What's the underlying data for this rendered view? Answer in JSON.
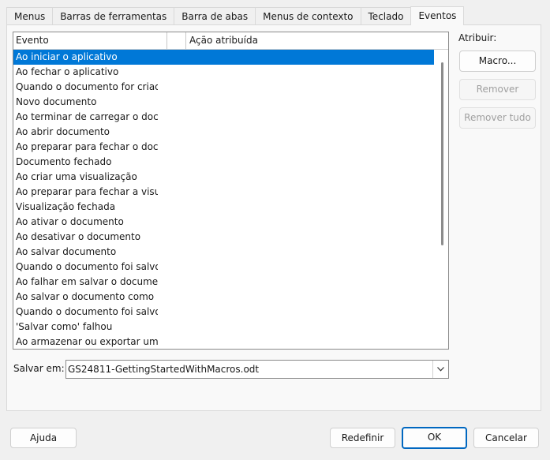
{
  "tabs": [
    "Menus",
    "Barras de ferramentas",
    "Barra de abas",
    "Menus de contexto",
    "Teclado",
    "Eventos"
  ],
  "active_tab": "Eventos",
  "events_table": {
    "header_event": "Evento",
    "header_action": "Ação atribuída",
    "rows": [
      "Ao iniciar o aplicativo",
      "Ao fechar o aplicativo",
      "Quando o documento for criado",
      "Novo documento",
      "Ao terminar de carregar o docume",
      "Ao abrir documento",
      "Ao preparar para fechar o docume",
      "Documento fechado",
      "Ao criar uma visualização",
      "Ao preparar para fechar a visualiza",
      "Visualização fechada",
      "Ao ativar o documento",
      "Ao desativar o documento",
      "Ao salvar documento",
      "Quando o documento foi salvo",
      "Ao falhar em salvar o documento",
      "Ao salvar o documento como",
      "Quando o documento foi salvo co",
      "'Salvar como' falhou",
      "Ao armazenar ou exportar uma cóp"
    ],
    "selected_row": "Ao iniciar o aplicativo"
  },
  "assign": {
    "label": "Atribuir:",
    "macro_button": "Macro...",
    "remove_button": "Remover",
    "remove_all_button": "Remover tudo"
  },
  "save_in": {
    "label": "Salvar em:",
    "value": "GS24811-GettingStartedWithMacros.odt"
  },
  "footer": {
    "help": "Ajuda",
    "reset": "Redefinir",
    "ok": "OK",
    "cancel": "Cancelar"
  },
  "colors": {
    "selection": "#0078d7",
    "default_button_border": "#0067c0"
  }
}
